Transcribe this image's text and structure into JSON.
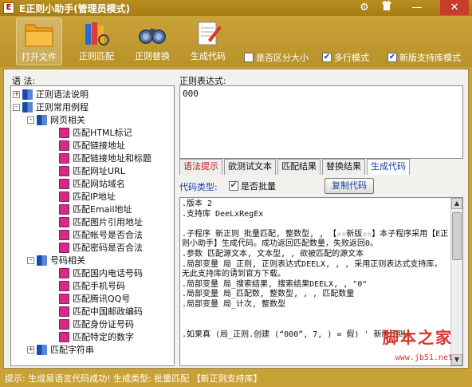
{
  "window": {
    "icon_letter": "E",
    "title": "E正则小助手(管理员模式)",
    "icons": [
      "settings-icon",
      "shirt-icon",
      "minimize-icon",
      "close-icon"
    ]
  },
  "toolbar": {
    "buttons": [
      {
        "label": "打开文件",
        "icon": "folder-icon"
      },
      {
        "label": "正则匹配",
        "icon": "books-icon"
      },
      {
        "label": "正则替换",
        "icon": "binoculars-icon"
      },
      {
        "label": "生成代码",
        "icon": "notepad-icon"
      }
    ],
    "options": [
      {
        "label": "是否区分大小",
        "checked": false
      },
      {
        "label": "多行模式",
        "checked": true
      },
      {
        "label": "新版支持库模式",
        "checked": true
      }
    ]
  },
  "left": {
    "label": "语 法:",
    "tree": [
      {
        "label": "正则语法说明",
        "level": 0,
        "expander": "+",
        "icon": "book-blue"
      },
      {
        "label": "正则常用例程",
        "level": 0,
        "expander": "-",
        "icon": "book-blue"
      },
      {
        "label": "网页相关",
        "level": 1,
        "expander": "-",
        "icon": "book-blue"
      },
      {
        "label": "匹配HTML标记",
        "level": 2,
        "icon": "book-pink"
      },
      {
        "label": "匹配链接地址",
        "level": 2,
        "icon": "book-pink"
      },
      {
        "label": "匹配链接地址和标题",
        "level": 2,
        "icon": "book-pink"
      },
      {
        "label": "匹配网址URL",
        "level": 2,
        "icon": "book-pink"
      },
      {
        "label": "匹配网站域名",
        "level": 2,
        "icon": "book-pink"
      },
      {
        "label": "匹配IP地址",
        "level": 2,
        "icon": "book-pink"
      },
      {
        "label": "匹配Email地址",
        "level": 2,
        "icon": "book-pink"
      },
      {
        "label": "匹配图片引用地址",
        "level": 2,
        "icon": "book-pink"
      },
      {
        "label": "匹配帐号是否合法",
        "level": 2,
        "icon": "book-pink"
      },
      {
        "label": "匹配密码是否合法",
        "level": 2,
        "icon": "book-pink"
      },
      {
        "label": "号码相关",
        "level": 1,
        "expander": "-",
        "icon": "book-blue"
      },
      {
        "label": "匹配国内电话号码",
        "level": 2,
        "icon": "book-pink"
      },
      {
        "label": "匹配手机号码",
        "level": 2,
        "icon": "book-pink"
      },
      {
        "label": "匹配腾讯QQ号",
        "level": 2,
        "icon": "book-pink"
      },
      {
        "label": "匹配中国邮政编码",
        "level": 2,
        "icon": "book-pink"
      },
      {
        "label": "匹配身份证号码",
        "level": 2,
        "icon": "book-pink"
      },
      {
        "label": "匹配特定的数字",
        "level": 2,
        "icon": "book-pink"
      },
      {
        "label": "匹配字符串",
        "level": 1,
        "expander": "+",
        "icon": "book-blue"
      }
    ]
  },
  "right": {
    "regex_label": "正则表达式:",
    "regex_value": "000",
    "tabs": [
      {
        "label": "语法提示",
        "style": "red"
      },
      {
        "label": "欲测试文本",
        "style": "normal"
      },
      {
        "label": "匹配结果",
        "style": "normal"
      },
      {
        "label": "替换结果",
        "style": "normal"
      },
      {
        "label": "生成代码",
        "style": "blue"
      }
    ],
    "code_type_label": "代码类型:",
    "batch_label": "是否批量",
    "batch_checked": true,
    "copy_button": "复制代码",
    "code": ".版本 2\n.支持库 DeeLxRegEx\n\n.子程序 新正则_批量匹配, 整数型, , 【☆☆新版☆☆】本子程序采用【E正则小助手】生成代码。成功返回匹配数量，失败返回0。\n.参数 匹配源文本, 文本型, , 欲被匹配的源文本\n.局部变量 局_正则, 正则表达式DEELX, , , 采用正则表达式支持库，无此支持库的请到官方下载。\n.局部变量 局_搜索结果, 搜索结果DEELX, , \"0\"\n.局部变量 局_匹配数, 整数型, , , 匹配数量\n.局部变量 局_计次, 整数型\n\n\n.如果真 (局_正则.创建 (“000”, 7, ) = 假) ' 新版正则"
  },
  "watermark": {
    "text": "脚本之家",
    "url": "www.jb51.net"
  },
  "status": {
    "text": "提示: 生成易语言代码成功! 生成类型: 批量匹配 【新正则支持库】"
  }
}
